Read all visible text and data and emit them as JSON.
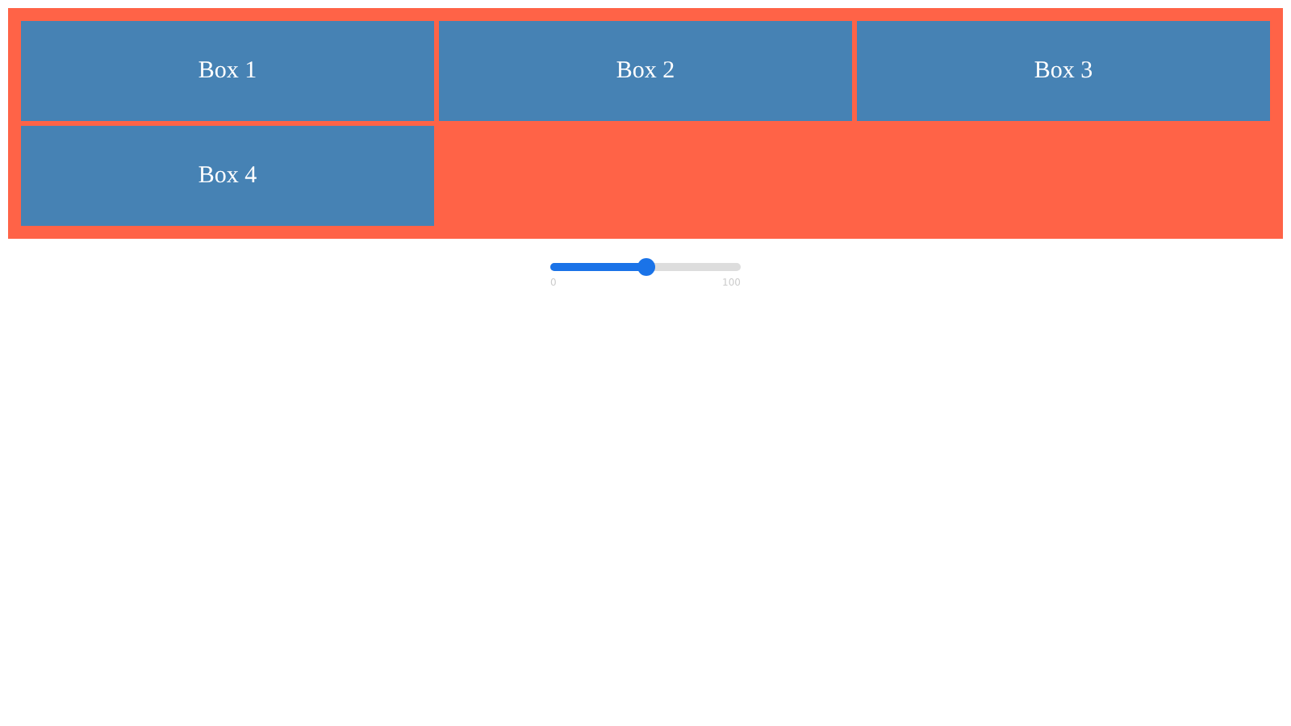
{
  "boxes": [
    {
      "label": "Box 1"
    },
    {
      "label": "Box 2"
    },
    {
      "label": "Box 3"
    },
    {
      "label": "Box 4"
    }
  ],
  "slider": {
    "level": 0.5,
    "min_label": "0",
    "max_label": "100"
  }
}
